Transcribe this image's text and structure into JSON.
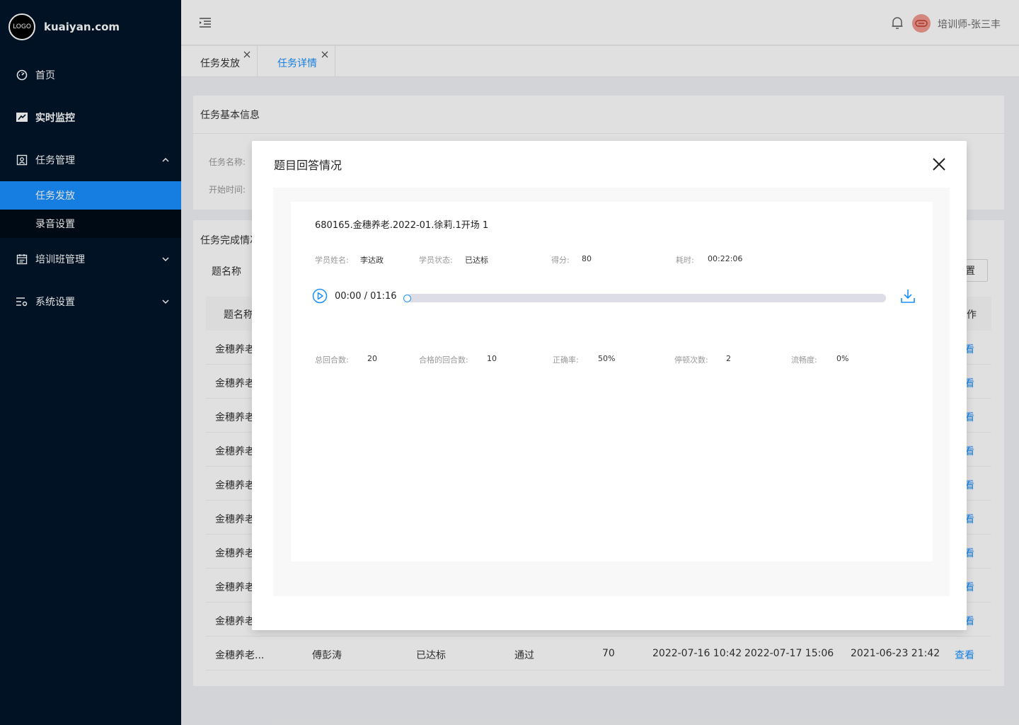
{
  "brand": {
    "logo_text": "LOGO",
    "site": "kuaiyan.com"
  },
  "sidebar": {
    "items": [
      {
        "label": "首页",
        "icon": "dashboard-icon"
      },
      {
        "label": "实时监控",
        "icon": "monitor-icon"
      },
      {
        "label": "任务管理",
        "icon": "task-icon",
        "expanded": true,
        "children": [
          {
            "label": "任务发放",
            "active": true
          },
          {
            "label": "录音设置"
          }
        ]
      },
      {
        "label": "培训班管理",
        "icon": "calendar-icon",
        "expanded": false
      },
      {
        "label": "系统设置",
        "icon": "settings-icon",
        "expanded": false
      }
    ]
  },
  "header": {
    "user": "培训师-张三丰"
  },
  "tabs": [
    {
      "label": "任务发放"
    },
    {
      "label": "任务详情",
      "active": true
    }
  ],
  "basic_info": {
    "title": "任务基本信息",
    "labels": [
      "任务名称:",
      "开始时间:"
    ]
  },
  "completion": {
    "title": "任务完成情况",
    "filter_label": "题名称",
    "search_button": "置",
    "headers": [
      "题名称",
      "作"
    ],
    "rows": [
      {
        "name": "金穗养老",
        "action": "看"
      },
      {
        "name": "金穗养老",
        "action": "看"
      },
      {
        "name": "金穗养老",
        "action": "看"
      },
      {
        "name": "金穗养老",
        "action": "看"
      },
      {
        "name": "金穗养老",
        "action": "看"
      },
      {
        "name": "金穗养老",
        "action": "看"
      },
      {
        "name": "金穗养老",
        "action": "看"
      },
      {
        "name": "金穗养老",
        "action": "看"
      },
      {
        "name": "金穗养老",
        "action": "看"
      }
    ],
    "last_row": {
      "name": "金穗养老...",
      "student": "傅彭涛",
      "status": "已达标",
      "result": "通过",
      "score": "70",
      "start": "2022-07-16 10:42",
      "end": "2022-07-17 15:06",
      "submitted": "2021-06-23 21:42",
      "action": "查看"
    }
  },
  "modal": {
    "title": "题目回答情况",
    "item_title": "680165.金穗养老.2022-01.徐莉.1开场 1",
    "student_name_label": "学员姓名:",
    "student_name": "李达政",
    "student_status_label": "学员状态:",
    "student_status": "已达标",
    "score_label": "得分:",
    "score": "80",
    "duration_label": "耗时:",
    "duration": "00:22:06",
    "player": {
      "time": "00:00 / 01:16",
      "progress": 0
    },
    "stats": {
      "total_rounds_label": "总回合数:",
      "total_rounds": "20",
      "qualified_rounds_label": "合格的回合数:",
      "qualified_rounds": "10",
      "accuracy_label": "正确率:",
      "accuracy": "50%",
      "pauses_label": "停顿次数:",
      "pauses": "2",
      "fluency_label": "流畅度:",
      "fluency": "0%"
    }
  }
}
